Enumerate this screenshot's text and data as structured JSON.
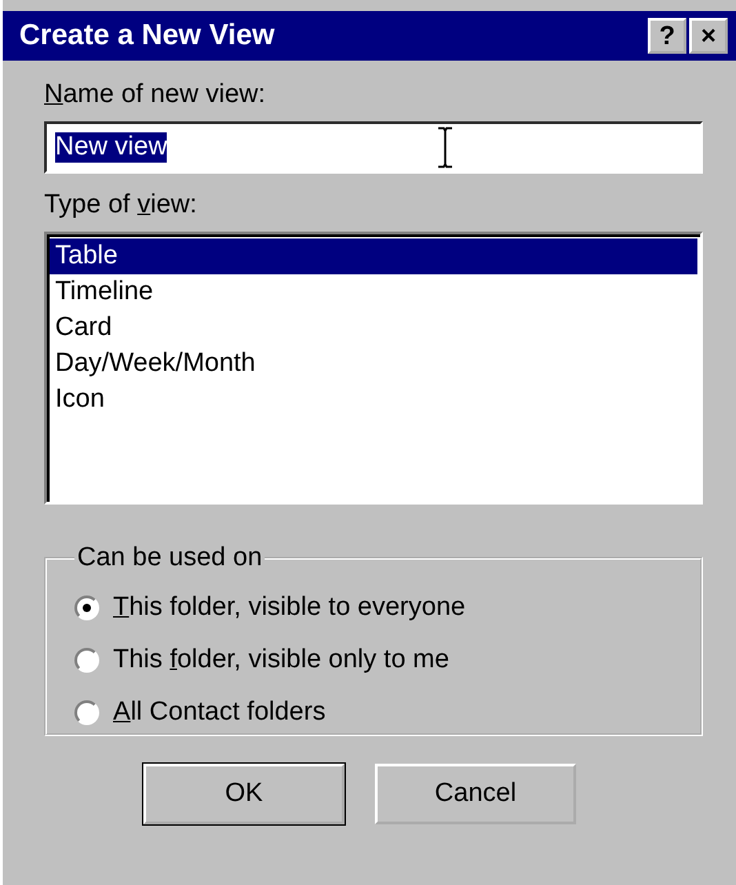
{
  "window": {
    "title": "Create a New View",
    "help_button": "?",
    "close_button": "×"
  },
  "name_field": {
    "label": [
      {
        "text": "N",
        "underline": true
      },
      {
        "text": "ame of new view:",
        "underline": false
      }
    ],
    "value": "New view",
    "value_selected": true
  },
  "type_list": {
    "label": [
      {
        "text": "Type of ",
        "underline": false
      },
      {
        "text": "v",
        "underline": true
      },
      {
        "text": "iew:",
        "underline": false
      }
    ],
    "items": [
      {
        "label": "Table",
        "selected": true
      },
      {
        "label": "Timeline",
        "selected": false
      },
      {
        "label": "Card",
        "selected": false
      },
      {
        "label": "Day/Week/Month",
        "selected": false
      },
      {
        "label": "Icon",
        "selected": false
      }
    ]
  },
  "can_be_used_on": {
    "title": "Can be used on",
    "options": [
      {
        "label": [
          {
            "text": "T",
            "underline": true
          },
          {
            "text": "his folder, visible to everyone",
            "underline": false
          }
        ],
        "selected": true
      },
      {
        "label": [
          {
            "text": "This ",
            "underline": false
          },
          {
            "text": "f",
            "underline": true
          },
          {
            "text": "older, visible only to me",
            "underline": false
          }
        ],
        "selected": false
      },
      {
        "label": [
          {
            "text": "A",
            "underline": true
          },
          {
            "text": "ll Contact folders",
            "underline": false
          }
        ],
        "selected": false
      }
    ]
  },
  "buttons": [
    {
      "label": "OK",
      "default": true
    },
    {
      "label": "Cancel",
      "default": false
    }
  ]
}
